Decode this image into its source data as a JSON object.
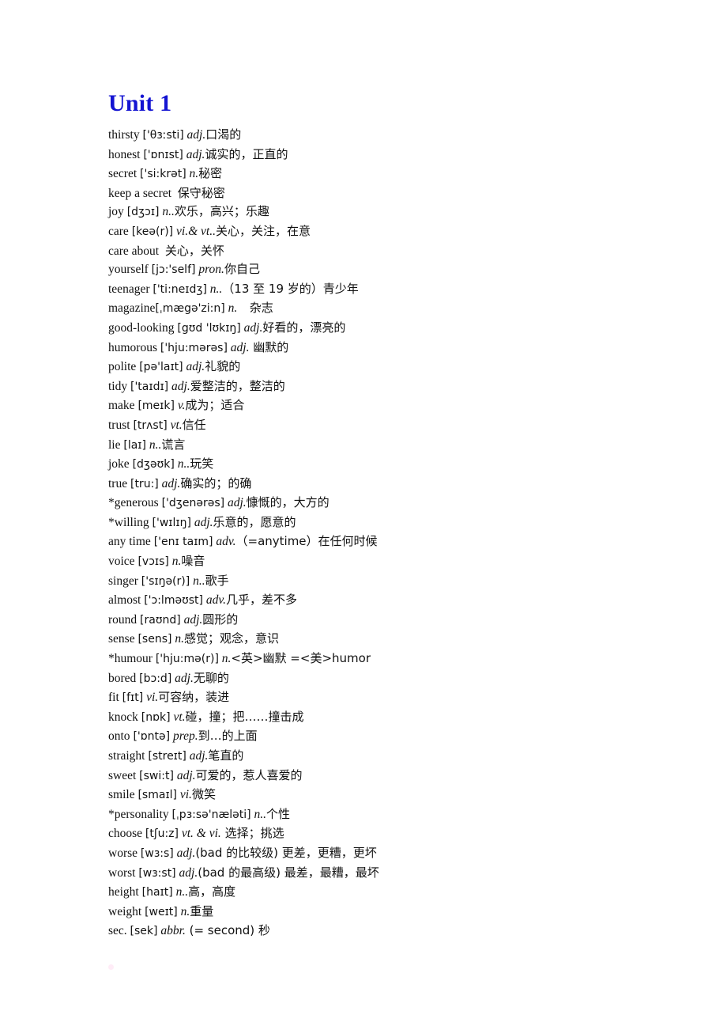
{
  "document": {
    "title": "Unit 1",
    "title_color": "#1414d2",
    "page_background": "#ffffff"
  },
  "vocabulary": {
    "entries": [
      {
        "word": "thirsty",
        "ipa": "['θɜːsti]",
        "pos": "adj.",
        "definition": "口渴的",
        "gap": ""
      },
      {
        "word": "honest",
        "ipa": "['ɒnɪst]",
        "pos": "adj.",
        "definition": "诚实的，正直的",
        "gap": ""
      },
      {
        "word": "secret",
        "ipa": "['si:krət]",
        "pos": "n.",
        "definition": "秘密",
        "gap": ""
      },
      {
        "word": "keep a secret",
        "ipa": "",
        "pos": "",
        "definition": "保守秘密",
        "gap": "  "
      },
      {
        "word": "joy",
        "ipa": "[dʒɔɪ]",
        "pos": "n..",
        "definition": "欢乐，高兴；乐趣",
        "gap": ""
      },
      {
        "word": "care",
        "ipa": "[keə(r)]",
        "pos": "vi.& vt..",
        "definition": "关心，关注，在意",
        "gap": ""
      },
      {
        "word": "care about",
        "ipa": "",
        "pos": "",
        "definition": "关心，关怀",
        "gap": "  "
      },
      {
        "word": "yourself",
        "ipa": "[jɔ:'self]",
        "pos": "pron.",
        "definition": "你自己",
        "gap": ""
      },
      {
        "word": "teenager",
        "ipa": "['ti:neɪdʒ]",
        "pos": "n..",
        "definition": "（13 至 19 岁的）青少年",
        "gap": ""
      },
      {
        "word": "magazine",
        "ipa": "[ˌmægə'zi:n]",
        "pos": "n.",
        "definition": "杂志",
        "gap": "    ",
        "no_space_before_ipa": true
      },
      {
        "word": "good-looking",
        "ipa": "[gʊd 'lʊkɪŋ]",
        "pos": "adj.",
        "definition": "好看的，漂亮的",
        "gap": ""
      },
      {
        "word": "humorous",
        "ipa": "['hju:mərəs]",
        "pos": "adj.",
        "definition": " 幽默的",
        "gap": ""
      },
      {
        "word": "polite",
        "ipa": "[pə'laɪt]",
        "pos": "adj.",
        "definition": "礼貌的",
        "gap": ""
      },
      {
        "word": "tidy",
        "ipa": "['taɪdɪ]",
        "pos": "adj.",
        "definition": "爱整洁的，整洁的",
        "gap": ""
      },
      {
        "word": "make",
        "ipa": "[meɪk]",
        "pos": "v.",
        "definition": "成为；适合",
        "gap": ""
      },
      {
        "word": "trust",
        "ipa": "[trʌst]",
        "pos": "vt.",
        "definition": "信任",
        "gap": ""
      },
      {
        "word": "lie",
        "ipa": "[laɪ]",
        "pos": "n..",
        "definition": "谎言",
        "gap": ""
      },
      {
        "word": "joke",
        "ipa": "[dʒəʊk]",
        "pos": "n..",
        "definition": "玩笑",
        "gap": ""
      },
      {
        "word": "true",
        "ipa": "[tru:]",
        "pos": "adj.",
        "definition": "确实的；的确",
        "gap": ""
      },
      {
        "word": "*generous",
        "ipa": "['dʒenərəs]",
        "pos": "adj.",
        "definition": "慷慨的，大方的",
        "gap": ""
      },
      {
        "word": "*willing",
        "ipa": "['wɪlɪŋ]",
        "pos": "adj.",
        "definition": "乐意的，愿意的",
        "gap": ""
      },
      {
        "word": "any time",
        "ipa": "['enɪ taɪm]",
        "pos": "adv.",
        "definition": "（=anytime）在任何时候",
        "gap": ""
      },
      {
        "word": "voice",
        "ipa": "[vɔɪs]",
        "pos": "n.",
        "definition": "噪音",
        "gap": ""
      },
      {
        "word": "singer",
        "ipa": "['sɪŋə(r)]",
        "pos": "n..",
        "definition": "歌手",
        "gap": ""
      },
      {
        "word": "almost",
        "ipa": "['ɔ:lməʊst]",
        "pos": "adv.",
        "definition": "几乎，差不多",
        "gap": ""
      },
      {
        "word": "round",
        "ipa": "[raʊnd]",
        "pos": "adj.",
        "definition": "圆形的",
        "gap": ""
      },
      {
        "word": "sense",
        "ipa": "[sens]",
        "pos": "n.",
        "definition": "感觉；观念，意识",
        "gap": ""
      },
      {
        "word": "*humour",
        "ipa": "['hju:mə(r)]",
        "pos": "n.",
        "definition": "<英>幽默 =<美>humor",
        "gap": ""
      },
      {
        "word": "bored",
        "ipa": "[bɔ:d]",
        "pos": "adj.",
        "definition": "无聊的",
        "gap": ""
      },
      {
        "word": "fit",
        "ipa": "[fɪt]",
        "pos": "vi.",
        "definition": "可容纳，装进",
        "gap": ""
      },
      {
        "word": "knock",
        "ipa": "[nɒk]",
        "pos": "vt.",
        "definition": "碰，撞；把……撞击成",
        "gap": ""
      },
      {
        "word": "onto",
        "ipa": "['ɒntə]",
        "pos": "prep.",
        "definition": "到…的上面",
        "gap": ""
      },
      {
        "word": "straight",
        "ipa": "[streɪt]",
        "pos": "adj.",
        "definition": "笔直的",
        "gap": ""
      },
      {
        "word": "sweet",
        "ipa": "[swi:t]",
        "pos": "adj.",
        "definition": "可爱的，惹人喜爱的",
        "gap": ""
      },
      {
        "word": "smile",
        "ipa": "[smaɪl]",
        "pos": "vi.",
        "definition": "微笑",
        "gap": ""
      },
      {
        "word": "*personality",
        "ipa": "[ˌpɜ:sə'næləti]",
        "pos": "n..",
        "definition": "个性",
        "gap": ""
      },
      {
        "word": "choose",
        "ipa": "[tʃu:z]",
        "pos": "vt. & vi.",
        "definition": " 选择；挑选",
        "gap": ""
      },
      {
        "word": "worse",
        "ipa": "[wɜ:s]",
        "pos": "adj.",
        "definition": "(bad 的比较级) 更差，更糟，更坏",
        "gap": ""
      },
      {
        "word": "worst",
        "ipa": "[wɜ:st]",
        "pos": "adj.",
        "definition": "(bad 的最高级) 最差，最糟，最坏",
        "gap": ""
      },
      {
        "word": "height",
        "ipa": "[haɪt]",
        "pos": "n..",
        "definition": "高，高度",
        "gap": ""
      },
      {
        "word": "weight",
        "ipa": "[weɪt]",
        "pos": "n.",
        "definition": "重量",
        "gap": ""
      },
      {
        "word": "sec.",
        "ipa": "[sek]",
        "pos": "abbr.",
        "definition": " (= second) 秒",
        "gap": ""
      }
    ]
  }
}
